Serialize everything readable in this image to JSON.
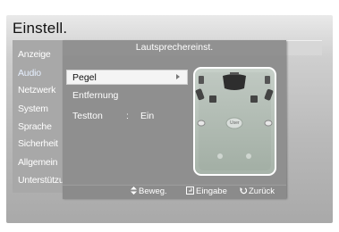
{
  "window": {
    "title": "Einstell."
  },
  "sidebar": {
    "items": [
      {
        "label": "Anzeige"
      },
      {
        "label": "Audio"
      },
      {
        "label": "Netzwerk"
      },
      {
        "label": "System"
      },
      {
        "label": "Sprache"
      },
      {
        "label": "Sicherheit"
      },
      {
        "label": "Allgemein"
      },
      {
        "label": "Unterstützu"
      }
    ]
  },
  "dialog": {
    "title": "Lautsprechereinst.",
    "menu": [
      {
        "label": "Pegel",
        "selected": true
      },
      {
        "label": "Entfernung"
      },
      {
        "label": "Testton",
        "separator": ":",
        "value": "Ein"
      }
    ],
    "center_label": "User"
  },
  "footer": {
    "move": "Beweg.",
    "enter": "Eingabe",
    "back": "Zurück"
  },
  "colors": {
    "dialog_bg": "#8f8f8f",
    "selection": "#f4f4f4",
    "room_bg": "#b7c2b9",
    "speaker": "#333333"
  }
}
